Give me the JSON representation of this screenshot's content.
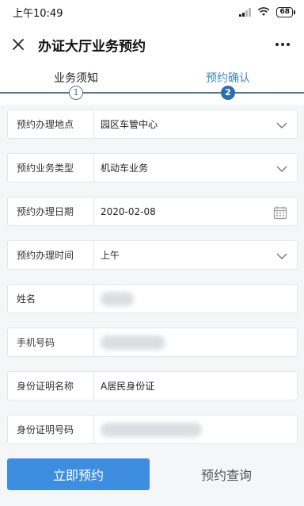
{
  "status_bar": {
    "time": "上午10:49",
    "battery": "68"
  },
  "header": {
    "title": "办证大厅业务预约"
  },
  "steps": [
    {
      "label": "业务须知",
      "number": "1",
      "state": "done"
    },
    {
      "label": "预约确认",
      "number": "2",
      "state": "active"
    }
  ],
  "form": {
    "location": {
      "label": "预约办理地点",
      "value": "园区车管中心"
    },
    "business_type": {
      "label": "预约业务类型",
      "value": "机动车业务"
    },
    "date": {
      "label": "预约办理日期",
      "value": "2020-02-08"
    },
    "time": {
      "label": "预约办理时间",
      "value": "上午"
    },
    "name": {
      "label": "姓名",
      "value": ""
    },
    "phone": {
      "label": "手机号码",
      "value": ""
    },
    "id_type": {
      "label": "身份证明名称",
      "value": "A居民身份证"
    },
    "id_number": {
      "label": "身份证明号码",
      "value": ""
    }
  },
  "actions": {
    "submit_label": "立即预约",
    "query_label": "预约查询"
  },
  "colors": {
    "primary": "#3d8ee0",
    "step_active": "#2b6fb0",
    "step_line": "#5a7590"
  }
}
